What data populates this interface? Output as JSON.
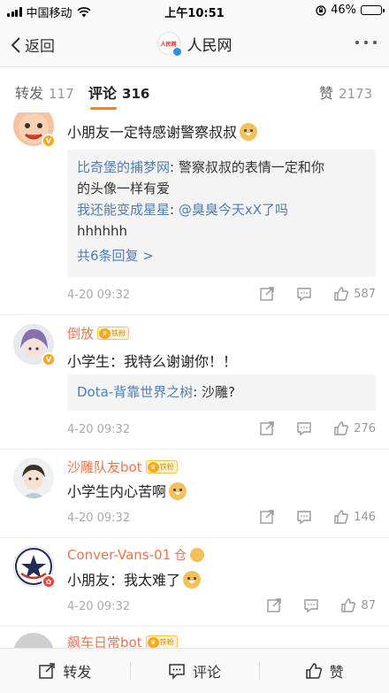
{
  "status_bar": {
    "carrier": "中国移动",
    "time": "上午10:51",
    "battery": "46%",
    "battery_level": 0.46
  },
  "nav": {
    "back_label": "返回",
    "account_name": "人民网",
    "logo_text": "人民网"
  },
  "tabs": [
    {
      "label": "转发",
      "count": "117"
    },
    {
      "label": "评论",
      "count": "316"
    },
    {
      "label": "赞",
      "count": "2173"
    }
  ],
  "comments": [
    {
      "username": "",
      "text": "小朋友一定特感谢警察叔叔",
      "replies": [
        {
          "name": "比奇堡的捕梦网",
          "text": "警察叔叔的表情一定和你",
          "text2": "的头像一样有爱"
        },
        {
          "name": "我还能变成星星",
          "text": "@臭臭今天xX了吗",
          "text2": "hhhhhh"
        }
      ],
      "more_replies": "共6条回复 >",
      "time": "4-20 09:32",
      "likes": "587"
    },
    {
      "username": "倒放",
      "badge": "铁粉",
      "text": "小学生：我特么谢谢你！！",
      "replies": [
        {
          "name": "Dota-背靠世界之树",
          "text": "沙雕?"
        }
      ],
      "time": "4-20 09:32",
      "likes": "276"
    },
    {
      "username": "沙雕队友bot",
      "badge": "铁粉",
      "text": "小学生内心苦啊",
      "time": "4-20 09:32",
      "likes": "146"
    },
    {
      "username": "Conver-Vans-01",
      "text": "小朋友：我太难了",
      "time": "4-20 09:32",
      "likes": "87"
    },
    {
      "username": "飙车日常bot",
      "badge": "铁粉"
    }
  ],
  "bottom_bar": {
    "repost": "转发",
    "comment": "评论",
    "like": "赞"
  },
  "colors": {
    "accent": "#ff8200",
    "username": "#eb7350",
    "link": "#4e7fb5"
  }
}
